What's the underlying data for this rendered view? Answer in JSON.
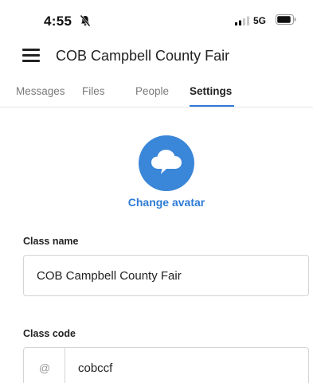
{
  "status_bar": {
    "time": "4:55",
    "network": "5G",
    "icons": [
      "bell-slash-icon",
      "signal-icon",
      "battery-icon"
    ]
  },
  "header": {
    "menu_icon": "hamburger-icon",
    "title": "COB Campbell County Fair"
  },
  "tabs": [
    {
      "label": "Messages",
      "active": false
    },
    {
      "label": "Files",
      "active": false
    },
    {
      "label": "People",
      "active": false
    },
    {
      "label": "Settings",
      "active": true
    }
  ],
  "avatar": {
    "icon": "cloud-speech-bubble-icon",
    "change_label": "Change avatar"
  },
  "class_name": {
    "label": "Class name",
    "value": "COB Campbell County Fair"
  },
  "class_code": {
    "label": "Class code",
    "prefix": "@",
    "value": "cobccf"
  },
  "colors": {
    "accent": "#2e7bd6",
    "avatar_bg": "#3a86d8"
  }
}
